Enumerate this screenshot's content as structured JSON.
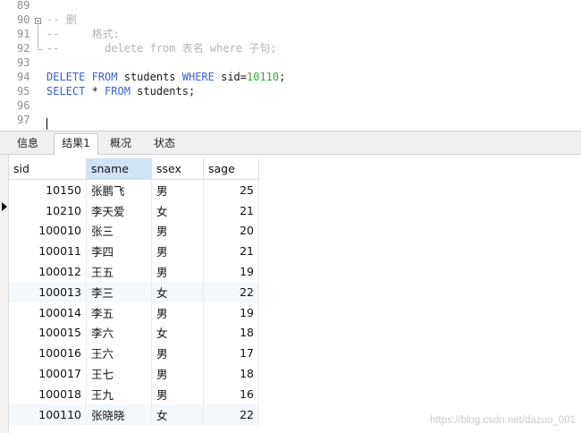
{
  "editor": {
    "lines": [
      {
        "num": "89",
        "segments": []
      },
      {
        "num": "90",
        "fold": "open",
        "segments": [
          {
            "cls": "cm",
            "text": "-- 删"
          }
        ]
      },
      {
        "num": "91",
        "segments": [
          {
            "cls": "cm",
            "text": "--     格式:"
          }
        ]
      },
      {
        "num": "92",
        "segments": [
          {
            "cls": "cm",
            "text": "--       delete from 表名 where 子句;"
          }
        ]
      },
      {
        "num": "93",
        "segments": []
      },
      {
        "num": "94",
        "segments": [
          {
            "cls": "kw",
            "text": "DELETE"
          },
          {
            "cls": "id",
            "text": " "
          },
          {
            "cls": "kw",
            "text": "FROM"
          },
          {
            "cls": "id",
            "text": " students "
          },
          {
            "cls": "kw",
            "text": "WHERE"
          },
          {
            "cls": "id",
            "text": " sid="
          },
          {
            "cls": "num",
            "text": "10110"
          },
          {
            "cls": "id",
            "text": ";"
          }
        ]
      },
      {
        "num": "95",
        "segments": [
          {
            "cls": "kw",
            "text": "SELECT"
          },
          {
            "cls": "id",
            "text": " * "
          },
          {
            "cls": "kw",
            "text": "FROM"
          },
          {
            "cls": "id",
            "text": " students;"
          }
        ]
      },
      {
        "num": "96",
        "segments": []
      },
      {
        "num": "97",
        "segments": []
      }
    ]
  },
  "tabs": [
    {
      "label": "信息",
      "active": false
    },
    {
      "label": "结果1",
      "active": true
    },
    {
      "label": "概况",
      "active": false
    },
    {
      "label": "状态",
      "active": false
    }
  ],
  "grid": {
    "columns": [
      "sid",
      "sname",
      "ssex",
      "sage"
    ],
    "selected_column": "sname",
    "current_row": 1,
    "rows": [
      [
        "10150",
        "张鹏飞",
        "男",
        "25"
      ],
      [
        "10210",
        "李天爱",
        "女",
        "21"
      ],
      [
        "100010",
        "张三",
        "男",
        "20"
      ],
      [
        "100011",
        "李四",
        "男",
        "21"
      ],
      [
        "100012",
        "王五",
        "男",
        "19"
      ],
      [
        "100013",
        "李三",
        "女",
        "22"
      ],
      [
        "100014",
        "李五",
        "男",
        "19"
      ],
      [
        "100015",
        "李六",
        "女",
        "18"
      ],
      [
        "100016",
        "王六",
        "男",
        "17"
      ],
      [
        "100017",
        "王七",
        "男",
        "18"
      ],
      [
        "100018",
        "王九",
        "男",
        "16"
      ],
      [
        "100110",
        "张晓晓",
        "女",
        "22"
      ]
    ]
  },
  "watermark": "https://blog.csdn.net/dazuo_001",
  "colors": {
    "keyword": "#3a5fd0",
    "number": "#3aa53a",
    "comment": "#b5b5b5",
    "header_selected": "#cfe3f5"
  }
}
